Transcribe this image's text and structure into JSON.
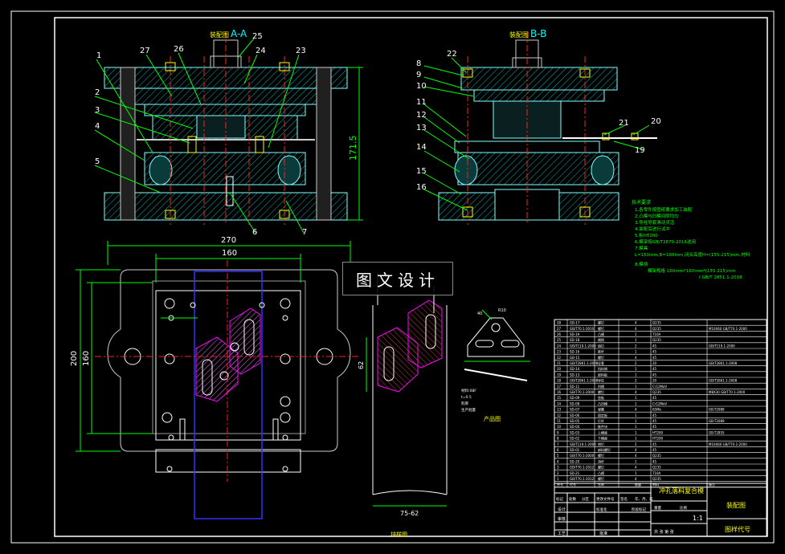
{
  "view_aa": {
    "title": "A-A",
    "title_prefix": "装配图"
  },
  "view_bb": {
    "title": "B-B",
    "title_prefix": "装配图"
  },
  "dims": {
    "height": "171.5",
    "width_total": "270",
    "width_inner": "160",
    "height_total": "200",
    "height_inner": "160",
    "strip_width": "62",
    "strip_bottom": "75-62"
  },
  "balloons_left": [
    "1",
    "2",
    "3",
    "4",
    "5"
  ],
  "balloons_top": [
    "27",
    "26",
    "25",
    "24",
    "23"
  ],
  "balloons_bottom": [
    "6",
    "7"
  ],
  "balloons_bb_left": [
    "8",
    "9",
    "10",
    "11",
    "12",
    "13",
    "14",
    "15",
    "16"
  ],
  "balloons_bb_top": [
    "22"
  ],
  "balloons_bb_right": [
    "21",
    "20",
    "19"
  ],
  "tech_notes": {
    "heading": "技术要求",
    "lines": [
      "1.各零件按图纸要求加工装配",
      "2.凸模与凹模间隙均匀",
      "3.导柱导套滑动灵活",
      "4.装配后进行试冲",
      "5.标HT200",
      "6.模架按GB/T2870-2016选用",
      "7.模具",
      "L=160mm,B=160mm,闭合高度H=(155-215)mm,材料",
      "8.模柄",
      "模架规格 160mm*160mm*(155-215)mm",
      "I GB/T 2851.1-2018"
    ]
  },
  "product": {
    "label": "产品图",
    "dim_a": "40",
    "dim_b": "R10"
  },
  "strip_label": "排样图",
  "small_notes": [
    "材料:08F",
    "t=0.5",
    "料厚",
    "生产批量"
  ],
  "title_block": {
    "part_name": "冲孔落料复合模",
    "drawing_type": "装配图",
    "drawing_no": "图样代号",
    "scale": "1:1",
    "row_designer": "设计",
    "row_check": "审核",
    "row_process": "工艺",
    "row_approve": "批准",
    "marks": "标记",
    "count": "处数",
    "zone": "分区",
    "change_doc": "更改文件号",
    "sign": "签名",
    "date": "年、月、日",
    "std": "标准化",
    "stage_mark": "阶段标记",
    "weight": "重量",
    "ratio": "比例",
    "sheets": "共 张 第 张"
  },
  "bom_rows": [
    {
      "no": "28",
      "code": "GB-17",
      "name": "螺钉",
      "qty": "4",
      "mat": "Q235",
      "note": ""
    },
    {
      "no": "27",
      "code": "GB/T70.1-2010",
      "name": "螺钉",
      "qty": "4",
      "mat": "Q235",
      "note": "M10X60 GB/T70.1-2000"
    },
    {
      "no": "26",
      "code": "SD-19",
      "name": "凸模",
      "qty": "1",
      "mat": "T10A",
      "note": ""
    },
    {
      "no": "25",
      "code": "SD-18",
      "name": "模柄",
      "qty": "1",
      "mat": "Q235",
      "note": ""
    },
    {
      "no": "24",
      "code": "GB/T119.1-2000",
      "name": "销钉",
      "qty": "2",
      "mat": "45",
      "note": "GB/T119.1-2000"
    },
    {
      "no": "23",
      "code": "SD-16",
      "name": "推杆",
      "qty": "1",
      "mat": "45",
      "note": ""
    },
    {
      "no": "22",
      "code": "GB-15",
      "name": "螺钉",
      "qty": "4",
      "mat": "45",
      "note": ""
    },
    {
      "no": "21",
      "code": "GB/T2861.1-2008",
      "name": "导套",
      "qty": "2",
      "mat": "20",
      "note": "GB/T2861.1-2008"
    },
    {
      "no": "20",
      "code": "SD-14",
      "name": "挡料销",
      "qty": "1",
      "mat": "45",
      "note": ""
    },
    {
      "no": "19",
      "code": "SD-13",
      "name": "卸料板",
      "qty": "1",
      "mat": "45",
      "note": ""
    },
    {
      "no": "18",
      "code": "GB/T2861.1-2008",
      "name": "导柱",
      "qty": "2",
      "mat": "20",
      "note": "GB/T2861.1-2008"
    },
    {
      "no": "17",
      "code": "SD-11",
      "name": "凹模",
      "qty": "1",
      "mat": "Cr12MoV",
      "note": ""
    },
    {
      "no": "16",
      "code": "GB/T70.1-2000",
      "name": "螺钉",
      "qty": "4",
      "mat": "Q235",
      "note": "M8X30 GB/T70.1-2000"
    },
    {
      "no": "15",
      "code": "SD-09",
      "name": "垫板",
      "qty": "1",
      "mat": "45",
      "note": ""
    },
    {
      "no": "14",
      "code": "SD-08",
      "name": "凸凹模",
      "qty": "1",
      "mat": "Cr12MoV",
      "note": ""
    },
    {
      "no": "13",
      "code": "SD-07",
      "name": "弹簧",
      "qty": "4",
      "mat": "65Mn",
      "note": "GB-T2089"
    },
    {
      "no": "12",
      "code": "SD-06",
      "name": "固定板",
      "qty": "1",
      "mat": "45",
      "note": ""
    },
    {
      "no": "11",
      "code": "SD-05",
      "name": "打杆",
      "qty": "1",
      "mat": "45",
      "note": "GB-T2089"
    },
    {
      "no": "10",
      "code": "SD-04",
      "name": "推件块",
      "qty": "1",
      "mat": "45",
      "note": ""
    },
    {
      "no": "9",
      "code": "SD-03",
      "name": "上模座",
      "qty": "1",
      "mat": "HT200",
      "note": "GB-T2855"
    },
    {
      "no": "8",
      "code": "SD-02",
      "name": "下模座",
      "qty": "1",
      "mat": "HT200",
      "note": ""
    },
    {
      "no": "7",
      "code": "GB/T119.1-2000",
      "name": "销钉",
      "qty": "2",
      "mat": "45",
      "note": "M10X60 GB/T70.1-2000"
    },
    {
      "no": "6",
      "code": "SD-01",
      "name": "卸料螺钉",
      "qty": "4",
      "mat": "45",
      "note": ""
    },
    {
      "no": "5",
      "code": "GB/T70.1-2000",
      "name": "螺钉",
      "qty": "4",
      "mat": "Q235",
      "note": ""
    },
    {
      "no": "4",
      "code": "SD-20",
      "name": "顶杆",
      "qty": "1",
      "mat": "45",
      "note": ""
    },
    {
      "no": "3",
      "code": "GB/T70.1-2012",
      "name": "螺钉",
      "qty": "4",
      "mat": "Q235",
      "note": ""
    },
    {
      "no": "2",
      "code": "SD-21",
      "name": "凸模",
      "qty": "1",
      "mat": "T10A",
      "note": ""
    },
    {
      "no": "1",
      "code": "GB/T70.1-2012",
      "name": "螺钉",
      "qty": "4",
      "mat": "Q235",
      "note": ""
    }
  ],
  "bom_header": {
    "no": "序号",
    "code": "代号",
    "name": "名称",
    "qty": "数量",
    "mat": "材料",
    "note": "备注"
  },
  "watermark": "图文设计",
  "colors": {
    "frame": "#ffffff",
    "outline": "#7fffff",
    "section": "#ffff00",
    "hatch_red": "#ff0000",
    "dim": "#00ff00",
    "center": "#ff2020",
    "blank": "#ff00ff",
    "blue": "#3030ff",
    "note": "#00ff00"
  }
}
